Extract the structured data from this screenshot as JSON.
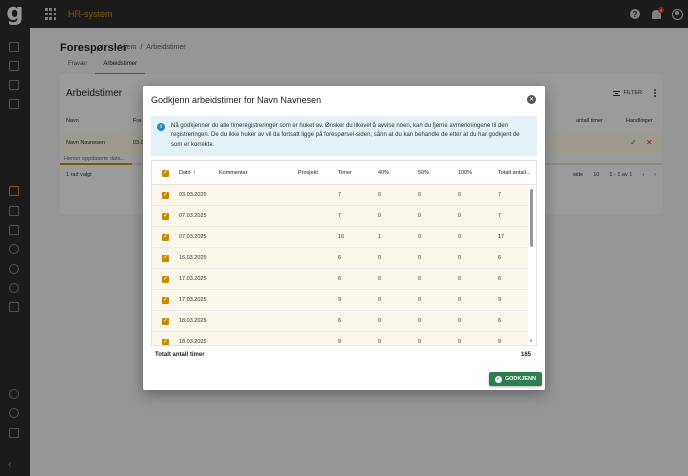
{
  "app": {
    "title": "HR-system",
    "logo": "g",
    "notification_count": "4"
  },
  "sidebar": {
    "items": [
      "home-icon",
      "folder-icon",
      "document-icon",
      "list-icon",
      "calendar-icon",
      "briefcase-icon",
      "tools-icon",
      "clock-icon",
      "add-user-icon",
      "user-check-icon",
      "table-icon",
      "person-icon",
      "group-icon",
      "building-icon",
      "collapse-icon"
    ]
  },
  "page": {
    "title": "Forespørsler",
    "breadcrumb": [
      "Hjem",
      "/",
      "Arbeidstimer"
    ],
    "tabs": [
      "Fravær",
      "Arbeidstimer"
    ],
    "card_title": "Arbeidstimer",
    "filter_label": "FILTER",
    "columns": [
      "Navn",
      "Fra",
      "antall timer",
      "Handlinger"
    ],
    "row": {
      "name": "Navn Navnesen",
      "from": "03.0"
    },
    "loading_text": "Henter oppdaterte data...",
    "selected_text": "1 rad valgt",
    "pager": {
      "per_page_label": "side",
      "per_page": "10",
      "range": "1 - 1 av 1"
    }
  },
  "dialog": {
    "title": "Godkjenn arbeidstimer for Navn Navnesen",
    "info": "Nå godkjenner du alle timeregistreringer som er huket av. Ønsker du likevel å avvise noen, kan du fjerne avmerkningene til den registreringen. De du ikke huker av vil da fortsatt ligge på forespørsel-siden, sånn at du kan behandle de etter at du har godkjent de som er korrekte.",
    "columns": {
      "dato": "Dato",
      "kommentar": "Kommentar",
      "prosjekt": "Prosjekt",
      "timer": "Timer",
      "p40": "40%",
      "p50": "50%",
      "p100": "100%",
      "totalt": "Totalt antall..."
    },
    "rows": [
      {
        "dato": "03.03.2025",
        "timer": "7",
        "p40": "0",
        "p50": "0",
        "p100": "0",
        "total": "7"
      },
      {
        "dato": "07.03.2025",
        "timer": "7",
        "p40": "0",
        "p50": "0",
        "p100": "0",
        "total": "7"
      },
      {
        "dato": "07.03.2025",
        "timer": "16",
        "p40": "1",
        "p50": "0",
        "p100": "0",
        "total": "17"
      },
      {
        "dato": "16.03.2025",
        "timer": "6",
        "p40": "0",
        "p50": "0",
        "p100": "0",
        "total": "6"
      },
      {
        "dato": "17.03.2025",
        "timer": "6",
        "p40": "0",
        "p50": "0",
        "p100": "0",
        "total": "6"
      },
      {
        "dato": "17.03.2025",
        "timer": "9",
        "p40": "0",
        "p50": "0",
        "p100": "0",
        "total": "9"
      },
      {
        "dato": "18.03.2025",
        "timer": "6",
        "p40": "0",
        "p50": "0",
        "p100": "0",
        "total": "6"
      },
      {
        "dato": "18.03.2025",
        "timer": "9",
        "p40": "0",
        "p50": "0",
        "p100": "0",
        "total": "9"
      }
    ],
    "total_label": "Totalt antall timer",
    "total_value": "165",
    "approve_label": "GODKJENN"
  },
  "colors": {
    "accent": "#c48a00",
    "topbar": "#2b2b2b",
    "approve": "#2e7d51",
    "info_bg": "#e4f2f8",
    "selected_row": "#fbf6ea"
  }
}
